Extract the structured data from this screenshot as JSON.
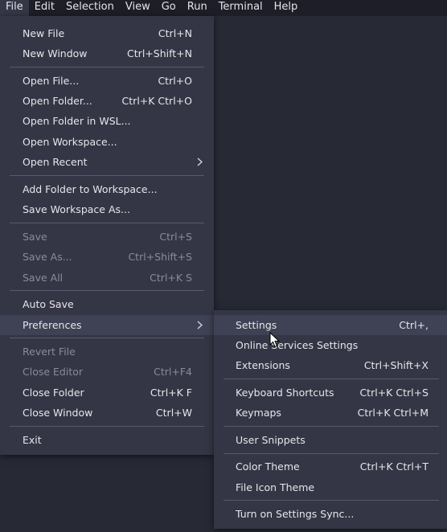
{
  "menubar": [
    "File",
    "Edit",
    "Selection",
    "View",
    "Go",
    "Run",
    "Terminal",
    "Help"
  ],
  "file_menu": {
    "new_file": {
      "label": "New File",
      "key": "Ctrl+N"
    },
    "new_window": {
      "label": "New Window",
      "key": "Ctrl+Shift+N"
    },
    "open_file": {
      "label": "Open File...",
      "key": "Ctrl+O"
    },
    "open_folder": {
      "label": "Open Folder...",
      "key": "Ctrl+K Ctrl+O"
    },
    "open_folder_wsl": {
      "label": "Open Folder in WSL..."
    },
    "open_workspace": {
      "label": "Open Workspace..."
    },
    "open_recent": {
      "label": "Open Recent"
    },
    "add_folder": {
      "label": "Add Folder to Workspace..."
    },
    "save_workspace_as": {
      "label": "Save Workspace As..."
    },
    "save": {
      "label": "Save",
      "key": "Ctrl+S"
    },
    "save_as": {
      "label": "Save As...",
      "key": "Ctrl+Shift+S"
    },
    "save_all": {
      "label": "Save All",
      "key": "Ctrl+K S"
    },
    "auto_save": {
      "label": "Auto Save"
    },
    "preferences": {
      "label": "Preferences"
    },
    "revert_file": {
      "label": "Revert File"
    },
    "close_editor": {
      "label": "Close Editor",
      "key": "Ctrl+F4"
    },
    "close_folder": {
      "label": "Close Folder",
      "key": "Ctrl+K F"
    },
    "close_window": {
      "label": "Close Window",
      "key": "Ctrl+W"
    },
    "exit": {
      "label": "Exit"
    }
  },
  "preferences_menu": {
    "settings": {
      "label": "Settings",
      "key": "Ctrl+,"
    },
    "online_services": {
      "label": "Online Services Settings"
    },
    "extensions": {
      "label": "Extensions",
      "key": "Ctrl+Shift+X"
    },
    "keyboard_shortcuts": {
      "label": "Keyboard Shortcuts",
      "key": "Ctrl+K Ctrl+S"
    },
    "keymaps": {
      "label": "Keymaps",
      "key": "Ctrl+K Ctrl+M"
    },
    "user_snippets": {
      "label": "User Snippets"
    },
    "color_theme": {
      "label": "Color Theme",
      "key": "Ctrl+K Ctrl+T"
    },
    "file_icon_theme": {
      "label": "File Icon Theme"
    },
    "settings_sync": {
      "label": "Turn on Settings Sync..."
    }
  },
  "icons": {
    "submenu": "chevron-right-icon",
    "pointer": "mouse-pointer-icon"
  },
  "colors": {
    "menubar": "#1d1e28",
    "menu_bg": "#343645",
    "highlight": "#3f4254",
    "editor_bg": "#272935",
    "disabled_text": "#8a8b96",
    "separator": "#585a6a"
  }
}
